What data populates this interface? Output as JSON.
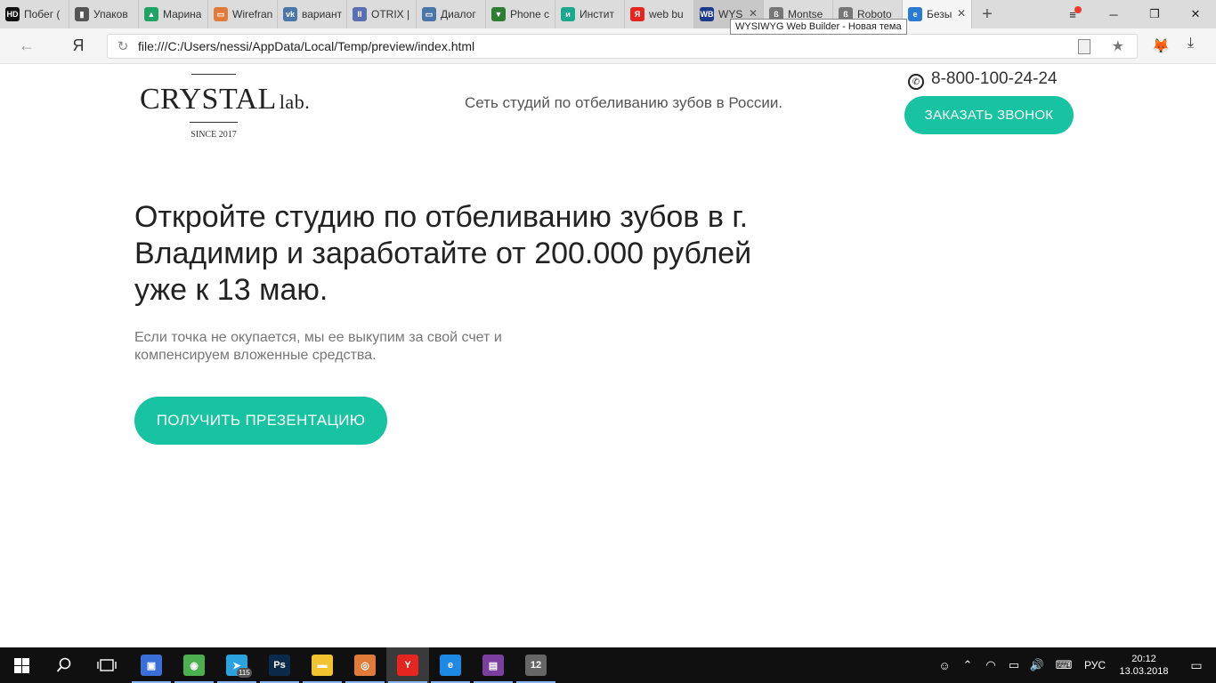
{
  "browser": {
    "tabs": [
      {
        "label": "Побег (",
        "fav": "HD",
        "fav_color": "#111111"
      },
      {
        "label": "Упаков",
        "fav": "▮",
        "fav_color": "#555555"
      },
      {
        "label": "Марина",
        "fav": "▲",
        "fav_color": "#1fa463"
      },
      {
        "label": "Wirefran",
        "fav": "▭",
        "fav_color": "#e07b39"
      },
      {
        "label": "вариант",
        "fav": "vk",
        "fav_color": "#4a76a8"
      },
      {
        "label": "OTRIX |",
        "fav": "II",
        "fav_color": "#5b6fb3"
      },
      {
        "label": "Диалог",
        "fav": "▭",
        "fav_color": "#4a76a8"
      },
      {
        "label": "Phone c",
        "fav": "▼",
        "fav_color": "#2e7d32"
      },
      {
        "label": "Инстит",
        "fav": "и",
        "fav_color": "#19a98c"
      },
      {
        "label": "web bu",
        "fav": "Я",
        "fav_color": "#e52620"
      },
      {
        "label": "WYS",
        "fav": "WB",
        "fav_color": "#1e3a8a"
      },
      {
        "label": "Montse",
        "fav": "ß",
        "fav_color": "#777777"
      },
      {
        "label": "Roboto",
        "fav": "ß",
        "fav_color": "#777777"
      },
      {
        "label": "Безы",
        "fav": "e",
        "fav_color": "#2a7ad2"
      }
    ],
    "new_tab": "+",
    "tooltip": "WYSIWYG Web Builder - Новая тема",
    "ya_label": "Я",
    "url": "file:///C:/Users/nessi/AppData/Local/Temp/preview/index.html",
    "icons": {
      "back": "←",
      "reload": "↻",
      "star": "★",
      "download": "⤓",
      "menu": "≡",
      "minimize": "─",
      "restore": "❐",
      "close": "✕"
    }
  },
  "site": {
    "logo_main": "CRYSTAL",
    "logo_sub": "lab.",
    "logo_since": "SINCE 2017",
    "tagline": "Сеть студий по отбеливанию зубов в России.",
    "phone": "8-800-100-24-24",
    "call_button": "ЗАКАЗАТЬ ЗВОНОК",
    "hero_title": "Откройте студию по отбеливанию зубов в г. Владимир и заработайте от 200.000 рублей уже к 13 маю.",
    "hero_sub": "Если точка не окупается, мы ее выкупим за свой счет и компенсируем вложенные средства.",
    "presentation_button": "ПОЛУЧИТЬ ПРЕЗЕНТАЦИЮ",
    "accent_color": "#17c3a1"
  },
  "taskbar": {
    "apps": [
      {
        "name": "computer-manager",
        "glyph": "▣",
        "color": "#3a6fd8"
      },
      {
        "name": "globe-app",
        "glyph": "◉",
        "color": "#4caf50"
      },
      {
        "name": "telegram",
        "glyph": "➤",
        "color": "#2aa3df"
      },
      {
        "name": "photoshop",
        "glyph": "Ps",
        "color": "#0b2a4a"
      },
      {
        "name": "file-explorer",
        "glyph": "▬",
        "color": "#f2c230"
      },
      {
        "name": "eye-app",
        "glyph": "◎",
        "color": "#e07b39"
      },
      {
        "name": "yandex-browser",
        "glyph": "Y",
        "color": "#e52620"
      },
      {
        "name": "edge",
        "glyph": "e",
        "color": "#1e88e5"
      },
      {
        "name": "winrar",
        "glyph": "▤",
        "color": "#7b3fa0"
      },
      {
        "name": "web-builder",
        "glyph": "12",
        "color": "#666666"
      }
    ],
    "telegram_badge": "115",
    "lang": "РУС",
    "time": "20:12",
    "date": "13.03.2018"
  }
}
